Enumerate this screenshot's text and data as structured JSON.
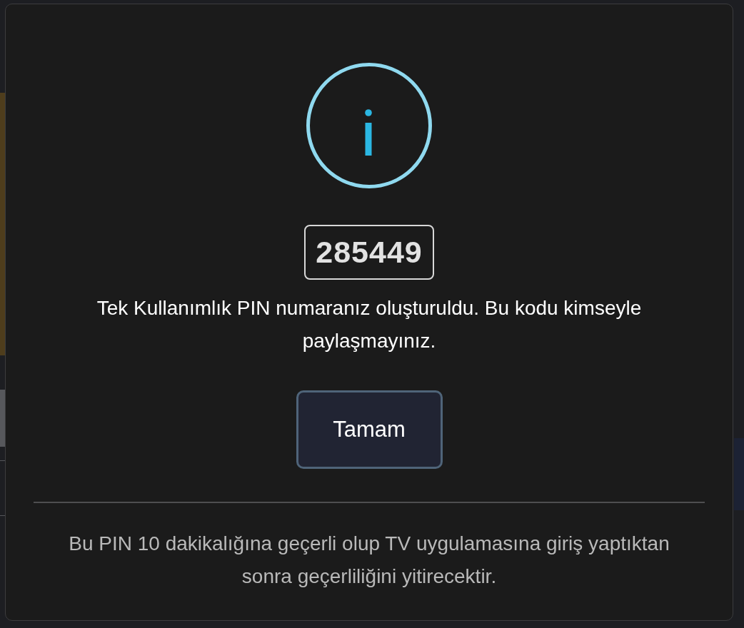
{
  "dialog": {
    "kind": "info",
    "pin": "285449",
    "message": "Tek Kullanımlık PIN numaranız oluşturuldu. Bu kodu kimseyle paylaşmayınız.",
    "buttons": [
      {
        "label": "Tamam"
      }
    ],
    "note": "Bu PIN 10 dakikalığına geçerli olup TV uygulamasına giriş yaptıktan sonra geçerliliğini yitirecektir."
  }
}
